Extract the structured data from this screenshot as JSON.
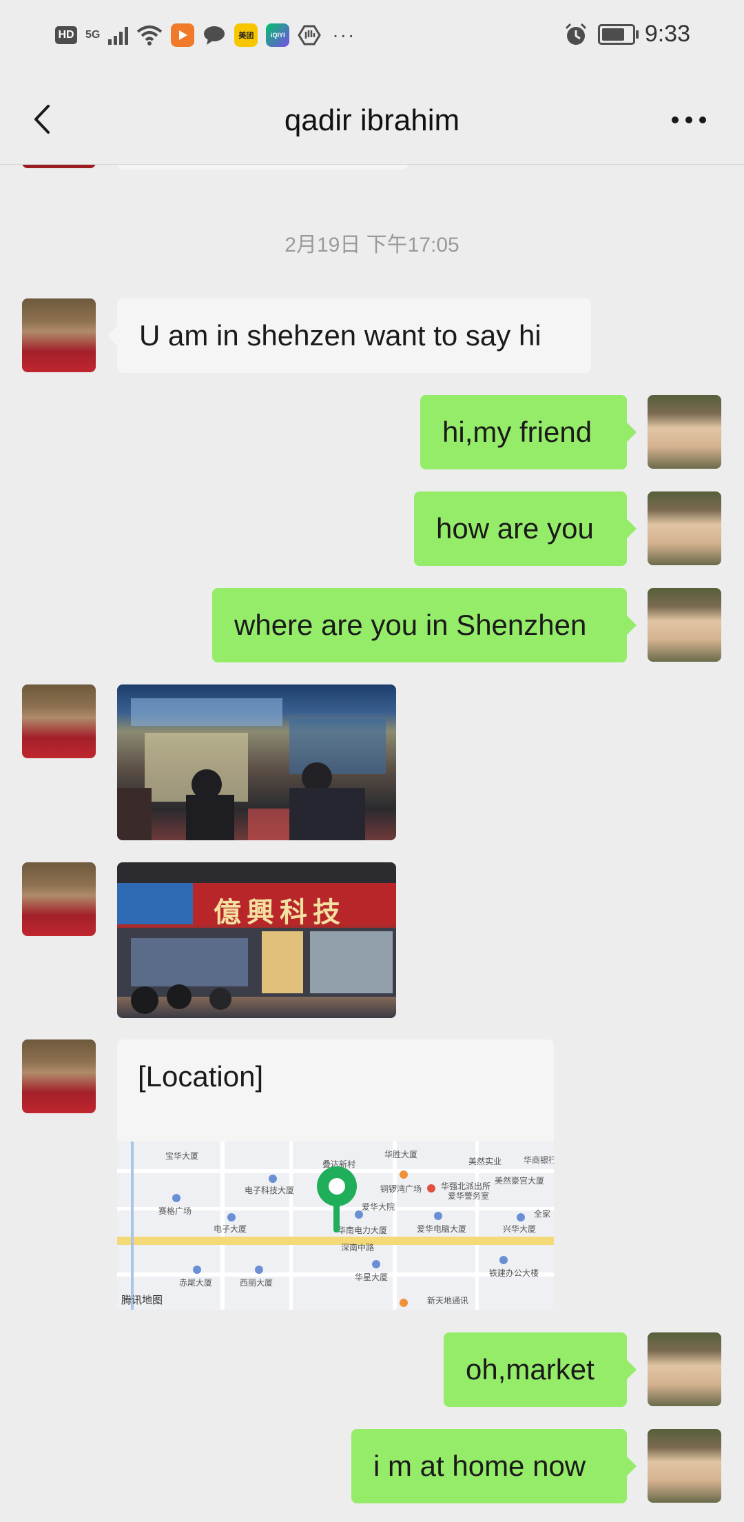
{
  "status_bar": {
    "hd": "HD",
    "network": "5G",
    "app1": "美团",
    "app2": "iQIYI",
    "more": "···",
    "time": "9:33",
    "battery_level": 0.75
  },
  "nav": {
    "title": "qadir ibrahim",
    "back_icon": "chevron-left-icon",
    "more_icon": "more-dots-icon"
  },
  "chat": {
    "timestamp": "2月19日 下午17:05",
    "messages": [
      {
        "from": "qadir",
        "type": "text",
        "text": "U am in shehzen want to say hi"
      },
      {
        "from": "me",
        "type": "text",
        "text": "hi,my friend"
      },
      {
        "from": "me",
        "type": "text",
        "text": "how are you"
      },
      {
        "from": "me",
        "type": "text",
        "text": "where are you in Shenzhen"
      },
      {
        "from": "qadir",
        "type": "image"
      },
      {
        "from": "qadir",
        "type": "image",
        "sign_text": "億興科技"
      },
      {
        "from": "qadir",
        "type": "location",
        "label": "[Location]",
        "map_credit": "腾讯地图"
      },
      {
        "from": "me",
        "type": "text",
        "text": "oh,market"
      },
      {
        "from": "me",
        "type": "text",
        "text": "i m at home now"
      }
    ]
  },
  "map_labels": {
    "l1": "宝华大厦",
    "l2": "电子科技大厦",
    "l3": "赛格广场",
    "l4": "电子大厦",
    "l5": "华强北派出所",
    "l6": "爱华警务室",
    "l7": "爱华大院",
    "l8": "华南电力大厦",
    "l9": "爱华电脑大厦",
    "l10": "深南中路",
    "l11": "华星大厦",
    "l12": "新天地通讯",
    "l13": "美然实业",
    "l14": "华商银行",
    "l15": "美然豪宫大厦",
    "l16": "兴华大厦",
    "l17": "铁建办公大楼",
    "l18": "赤尾大厦",
    "l19": "西丽大厦",
    "l20": "叠达新村",
    "l21": "华胜大厦",
    "l22": "铜锣湾广场",
    "l23": "全家"
  },
  "colors": {
    "background": "#ededed",
    "incoming_bubble": "#f5f5f5",
    "outgoing_bubble": "#95ec69",
    "map_pin": "#1fae59"
  }
}
